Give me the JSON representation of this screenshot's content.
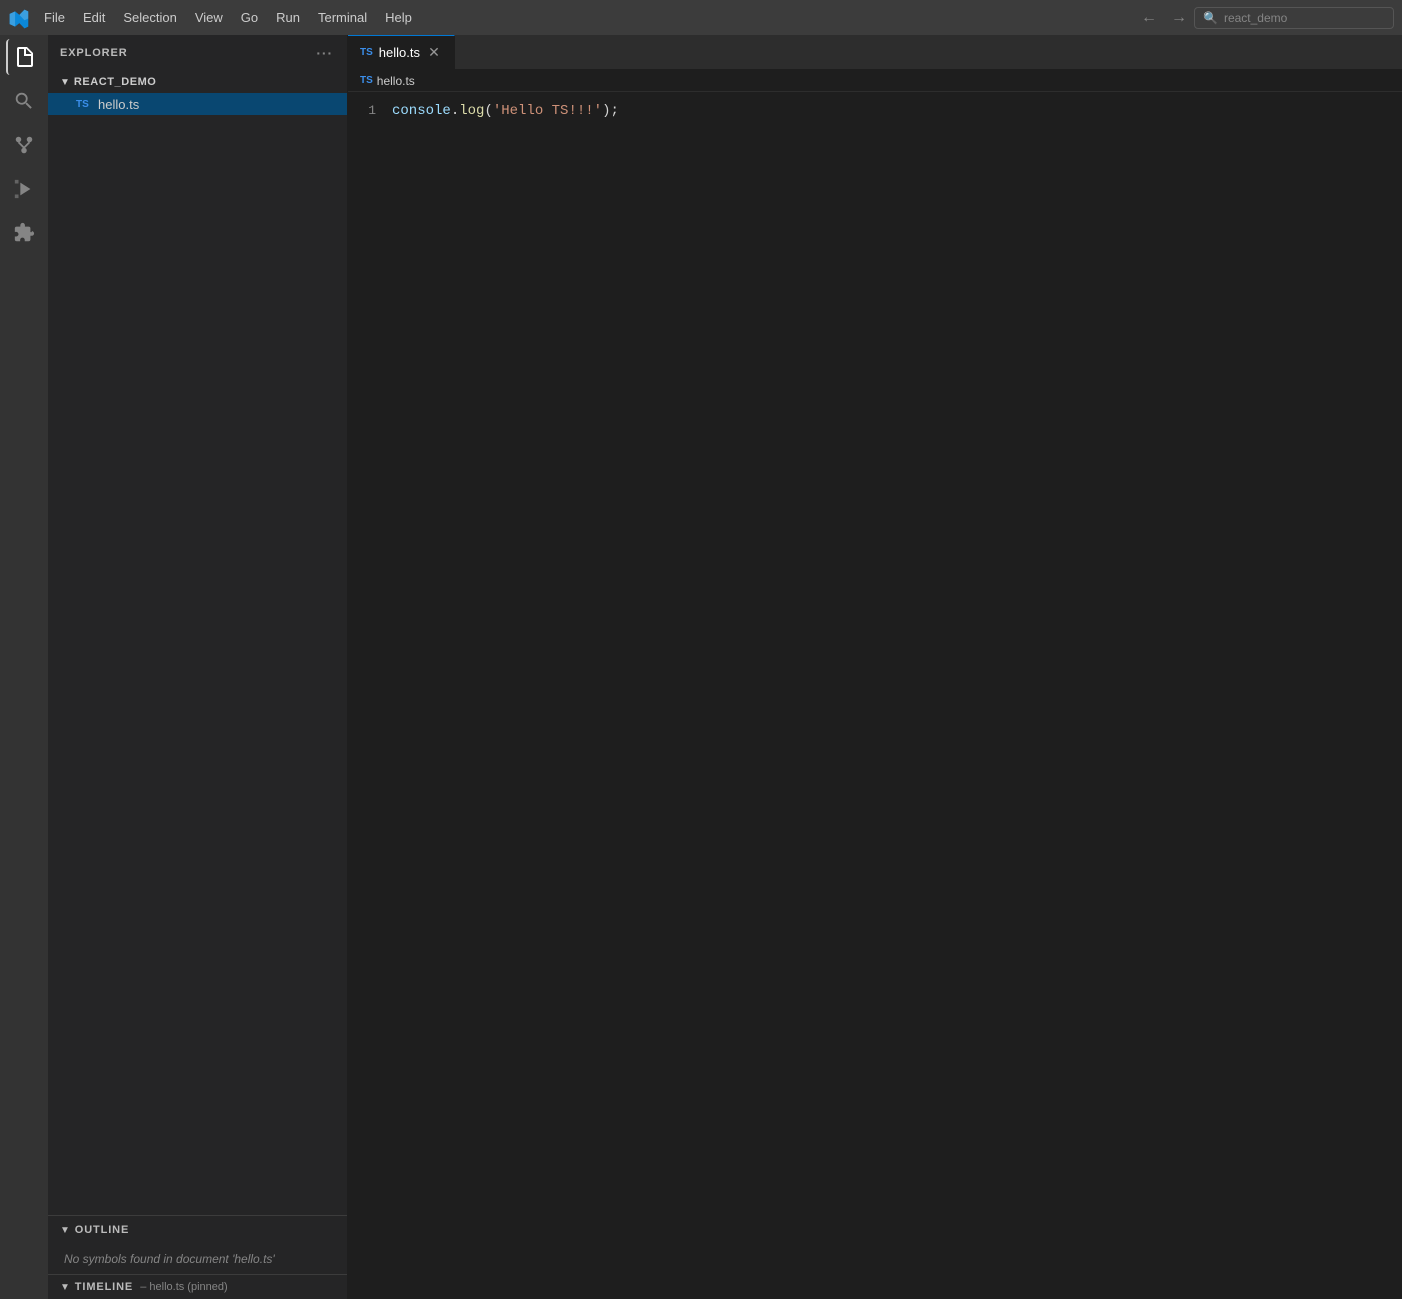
{
  "titlebar": {
    "menu_items": [
      "File",
      "Edit",
      "Selection",
      "View",
      "Go",
      "Run",
      "Terminal",
      "Help"
    ],
    "search_placeholder": "react_demo"
  },
  "activity_bar": {
    "icons": [
      "explorer",
      "search",
      "source-control",
      "run-debug",
      "extensions"
    ]
  },
  "sidebar": {
    "explorer_header": "EXPLORER",
    "more_label": "···",
    "project": {
      "name": "REACT_DEMO",
      "files": [
        {
          "name": "hello.ts",
          "type": "ts",
          "active": true
        }
      ]
    },
    "outline": {
      "header": "OUTLINE",
      "empty_message": "No symbols found in document 'hello.ts'"
    },
    "timeline": {
      "header": "TIMELINE",
      "subtitle": "hello.ts (pinned)"
    }
  },
  "editor": {
    "tabs": [
      {
        "name": "hello.ts",
        "type": "ts",
        "active": true
      }
    ],
    "breadcrumb": "hello.ts",
    "code_lines": [
      {
        "number": "1",
        "content": "console.log('Hello TS!!!');",
        "tokens": [
          {
            "text": "console",
            "class": "kw-console"
          },
          {
            "text": ".",
            "class": "kw-dot"
          },
          {
            "text": "log",
            "class": "kw-log"
          },
          {
            "text": "(",
            "class": "kw-semi"
          },
          {
            "text": "'Hello TS!!!'",
            "class": "kw-string"
          },
          {
            "text": ");",
            "class": "kw-semi"
          }
        ]
      }
    ]
  }
}
